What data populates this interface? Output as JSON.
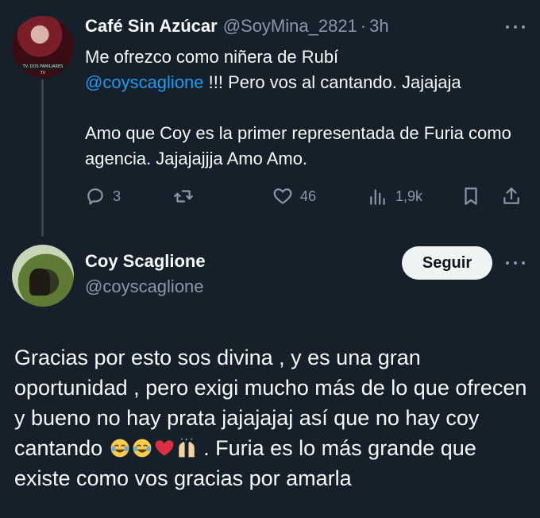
{
  "tweet_parent": {
    "display_name": "Café Sin Azúcar",
    "handle": "@SoyMina_2821",
    "separator": "·",
    "time": "3h",
    "avatar_caption": "TV. DOS FAMILIARES TV",
    "text_line_1_before": "Me ofrezco como niñera de Rubí",
    "mention": "@coyscaglione",
    "text_line_1_after": " !!! Pero vos al cantando. Jajajaja",
    "text_paragraph_2": "Amo que Coy es la primer representada de Furia como agencia. Jajajajjja Amo Amo.",
    "actions": {
      "reply_count": "3",
      "like_count": "46",
      "views_count": "1,9k"
    },
    "icons": [
      "reply-icon",
      "retweet-icon",
      "like-icon",
      "views-icon",
      "bookmark-icon",
      "share-icon",
      "more-icon"
    ]
  },
  "tweet_main": {
    "display_name": "Coy Scaglione",
    "handle": "@coyscaglione",
    "follow_label": "Seguir",
    "text_part_1": "Gracias por esto sos divina , y es una gran oportunidad , pero exigi mucho más de lo que ofrecen y bueno no hay prata jajajajaj así que no hay coy cantando ",
    "emojis": [
      "joy-emoji",
      "joy-emoji",
      "red-heart-emoji",
      "raising-hands-emoji"
    ],
    "text_part_2": " . Furia es lo más grande que existe como vos gracias por amarla"
  },
  "colors": {
    "background": "#15202b",
    "primary_text": "#f7f9f9",
    "secondary_text": "#8b98a5",
    "accent": "#1d9bf0",
    "follow_button_bg": "#eff3f4"
  }
}
